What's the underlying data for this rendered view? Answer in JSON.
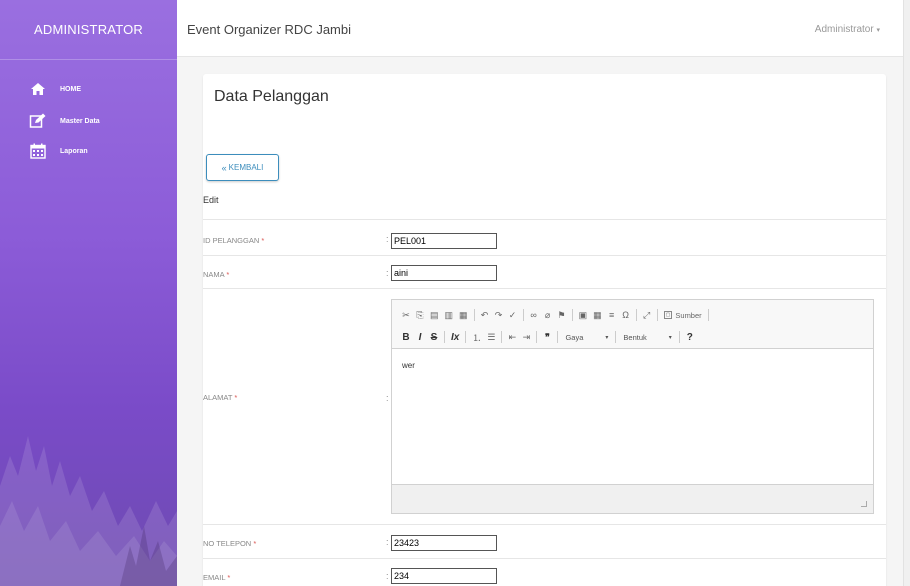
{
  "sidebar": {
    "brand": "ADMINISTRATOR",
    "items": [
      {
        "label": "HOME",
        "icon": "home-icon"
      },
      {
        "label": "Master Data",
        "icon": "edit-icon"
      },
      {
        "label": "Laporan",
        "icon": "calendar-icon"
      }
    ]
  },
  "topbar": {
    "app_title": "Event Organizer RDC Jambi",
    "user_menu": "Administrator"
  },
  "page": {
    "title": "Data Pelanggan",
    "back_button": "KEMBALI",
    "section": "Edit"
  },
  "form": {
    "id_label": "ID PELANGGAN",
    "id_value": "PEL001",
    "nama_label": "NAMA",
    "nama_value": "aini",
    "alamat_label": "ALAMAT",
    "alamat_value": "wer",
    "telepon_label": "NO TELEPON",
    "telepon_value": "23423",
    "email_label": "EMAIL",
    "email_value": "234",
    "required_mark": "*",
    "colon": ":"
  },
  "editor": {
    "source_label": "Sumber",
    "style_combo": "Gaya",
    "format_combo": "Bentuk",
    "help": "?"
  },
  "colors": {
    "sidebar": "#8c5cd8",
    "accent": "#3c8dbc",
    "required": "#d9534f"
  }
}
